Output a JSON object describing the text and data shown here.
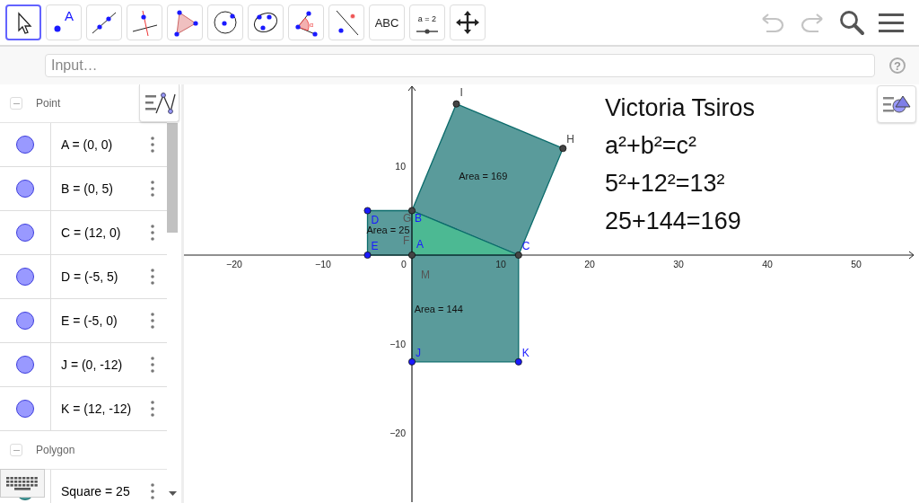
{
  "toolbar": {
    "tools": [
      {
        "kind": "move",
        "selected": true
      },
      {
        "kind": "point",
        "label": "A",
        "selected": false
      },
      {
        "kind": "line",
        "selected": false
      },
      {
        "kind": "perpendicular",
        "selected": false
      },
      {
        "kind": "polygon",
        "selected": false
      },
      {
        "kind": "circle",
        "selected": false
      },
      {
        "kind": "conic",
        "selected": false
      },
      {
        "kind": "angle",
        "label": "α",
        "selected": false
      },
      {
        "kind": "reflect",
        "selected": false
      },
      {
        "kind": "text",
        "label": "ABC",
        "selected": false
      },
      {
        "kind": "slider",
        "label": "a = 2",
        "selected": false
      },
      {
        "kind": "pan",
        "selected": false
      }
    ],
    "undo": {
      "disabled": true
    },
    "redo": {
      "disabled": true
    }
  },
  "input_bar": {
    "placeholder": "Input…",
    "help": "?"
  },
  "algebra": {
    "groups": [
      {
        "title": "Point",
        "kind": "point",
        "expanded": true,
        "items": [
          {
            "text": "A = (0, 0)",
            "shown": true
          },
          {
            "text": "B = (0, 5)",
            "shown": true
          },
          {
            "text": "C = (12, 0)",
            "shown": true
          },
          {
            "text": "D = (-5, 5)",
            "shown": true
          },
          {
            "text": "E = (-5, 0)",
            "shown": true
          },
          {
            "text": "J = (0, -12)",
            "shown": true
          },
          {
            "text": "K = (12, -12)",
            "shown": true
          }
        ]
      },
      {
        "title": "Polygon",
        "kind": "polygon",
        "expanded": true,
        "items": [
          {
            "text": "Square = 25",
            "shown": true
          }
        ]
      }
    ]
  },
  "graphics": {
    "x_ticks": [
      "−20",
      "−10",
      "0",
      "10",
      "20",
      "30",
      "40",
      "50"
    ],
    "y_ticks": [
      "10",
      "−10",
      "−20"
    ],
    "polygons": [
      {
        "kind": "square",
        "caption": "Area = 169"
      },
      {
        "kind": "square",
        "caption": "Area = 25"
      },
      {
        "kind": "square",
        "caption": "Area = 144"
      },
      {
        "kind": "triangle"
      }
    ],
    "points": [
      {
        "label": "I",
        "kind": "dependent"
      },
      {
        "label": "H",
        "kind": "dependent"
      },
      {
        "label": "D",
        "kind": "free"
      },
      {
        "label": "B",
        "kind": "fixed"
      },
      {
        "label": "E",
        "kind": "free"
      },
      {
        "label": "A",
        "kind": "fixed"
      },
      {
        "label": "C",
        "kind": "fixed"
      },
      {
        "label": "J",
        "kind": "free"
      },
      {
        "label": "K",
        "kind": "free"
      }
    ],
    "labels": [
      "G",
      "F",
      "M"
    ],
    "texts": [
      "Victoria Tsiros",
      "a²+b²=c²",
      "5²+12²=13²",
      "25+144=169"
    ]
  }
}
